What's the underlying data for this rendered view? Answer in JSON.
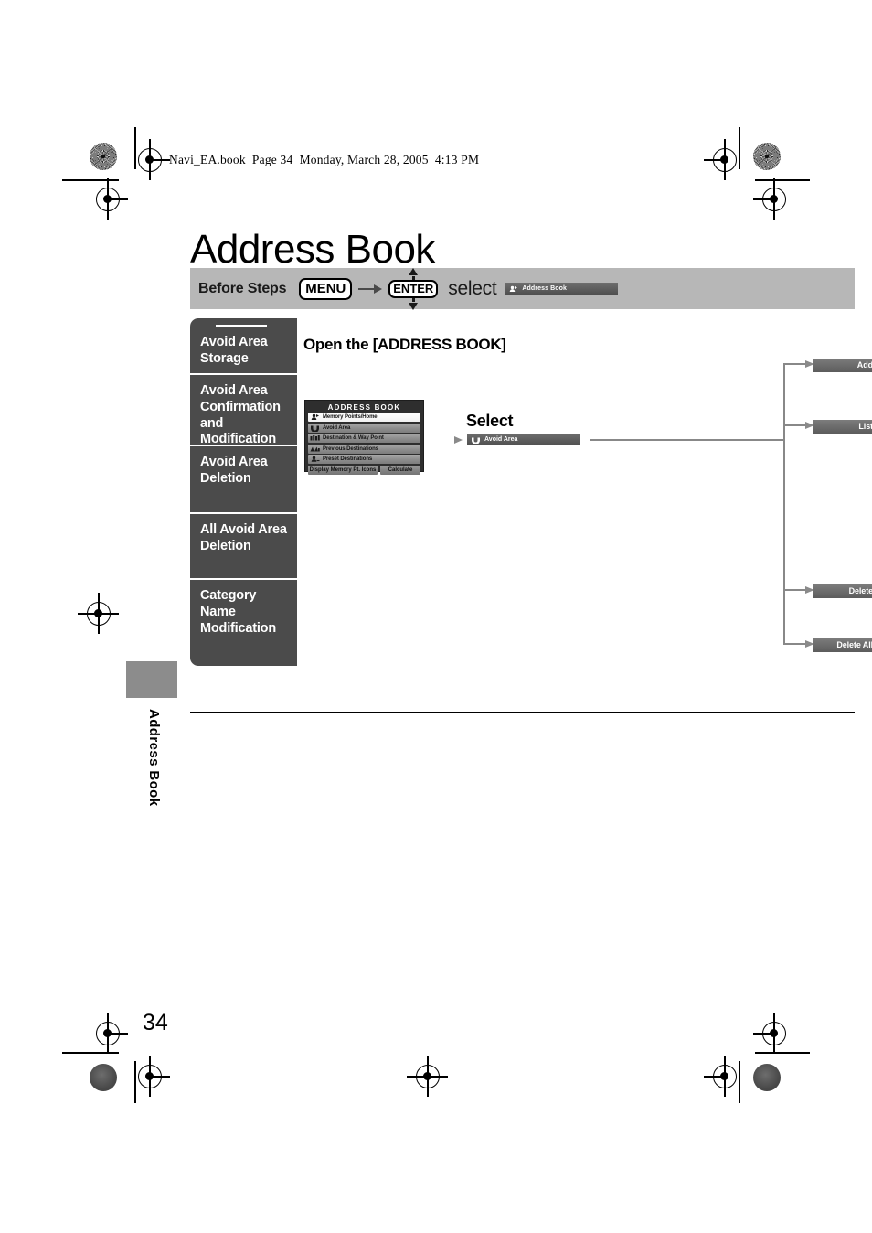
{
  "print_header": {
    "text": "Navi_EA.book  Page 34  Monday, March 28, 2005  4:13 PM"
  },
  "page": {
    "title": "Address Book",
    "number": "34",
    "side_tab_label": "Address Book"
  },
  "before_steps": {
    "label": "Before Steps",
    "menu_key": "MENU",
    "enter_key": "ENTER",
    "select_word": "select",
    "target_chip": "Address Book",
    "arrow_icon": "arrow-right-icon",
    "up_icon": "arrow-up-icon",
    "down_icon": "arrow-down-icon"
  },
  "sidebar": {
    "items": [
      {
        "label": "Avoid Area Storage"
      },
      {
        "label": "Avoid Area Confirmation and Modification"
      },
      {
        "label": "Avoid Area Deletion"
      },
      {
        "label": "All Avoid Area Deletion"
      },
      {
        "label": "Category Name Modification"
      }
    ]
  },
  "step": {
    "heading": "Open the [ADDRESS BOOK]"
  },
  "nav_screen": {
    "title": "ADDRESS BOOK",
    "rows": [
      {
        "label": "Memory Points/Home",
        "icon": "memory-point-icon",
        "selected": true
      },
      {
        "label": "Avoid Area",
        "icon": "avoid-area-icon",
        "selected": false
      },
      {
        "label": "Destination & Way Point",
        "icon": "waypoint-icon",
        "selected": false
      },
      {
        "label": "Previous Destinations",
        "icon": "previous-destination-icon",
        "selected": false
      },
      {
        "label": "Preset Destinations",
        "icon": "preset-destination-icon",
        "selected": false
      }
    ],
    "footer": {
      "left_button": "Display Memory Pt. Icons",
      "right_button": "Calculate"
    }
  },
  "select_step": {
    "heading": "Select",
    "chip_label": "Avoid Area",
    "chip_icon": "avoid-area-icon"
  },
  "outputs": [
    {
      "label": "Add"
    },
    {
      "label": "List"
    },
    {
      "label": "Delete"
    },
    {
      "label": "Delete All"
    }
  ],
  "colors": {
    "sidebar_bg": "#4b4b4b",
    "before_bar_bg": "#b7b7b7",
    "chip_gray": "#5d5d5d",
    "connector": "#888888",
    "thumb_tab": "#8c8c8c"
  }
}
